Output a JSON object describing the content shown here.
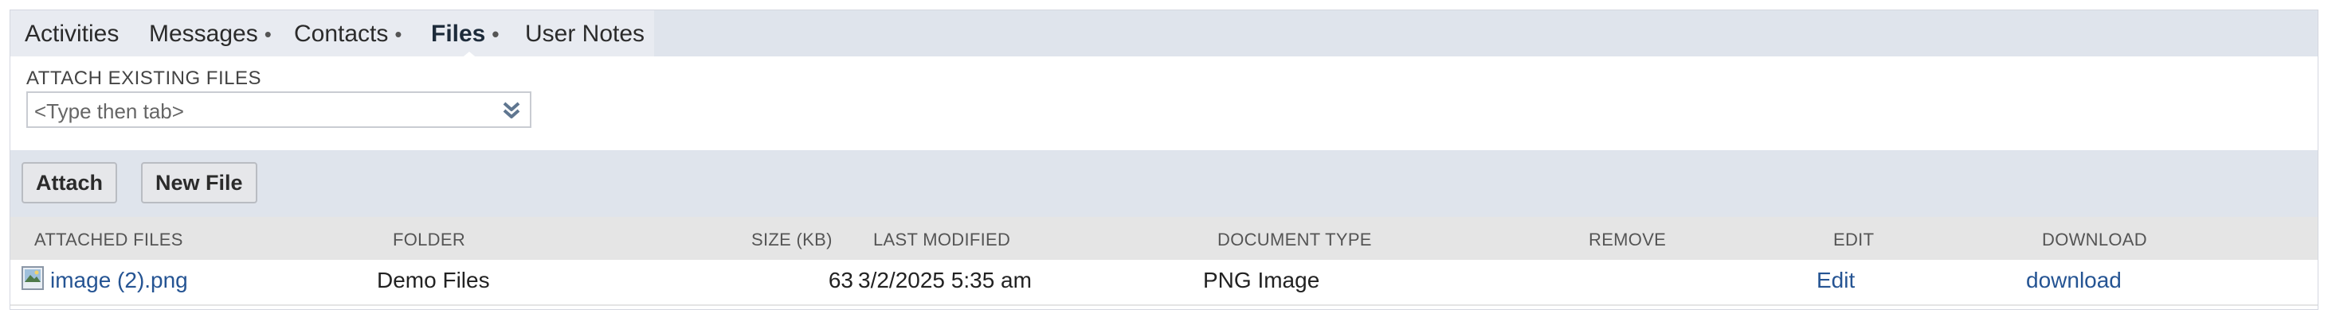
{
  "tabs": [
    {
      "label": "Activities"
    },
    {
      "label": "Messages",
      "marker": "•"
    },
    {
      "label": "Contacts",
      "marker": "•"
    },
    {
      "label": "Files",
      "marker": "•"
    },
    {
      "label": "User Notes"
    }
  ],
  "active_tab": "Files",
  "attach_existing": {
    "label": "ATTACH EXISTING FILES",
    "placeholder": "<Type then tab>"
  },
  "buttons": {
    "attach": "Attach",
    "new_file": "New File"
  },
  "table": {
    "columns": [
      "ATTACHED FILES",
      "FOLDER",
      "SIZE (KB)",
      "LAST MODIFIED",
      "DOCUMENT TYPE",
      "REMOVE",
      "EDIT",
      "DOWNLOAD"
    ],
    "rows": [
      {
        "file": "image (2).png",
        "folder": "Demo Files",
        "size_kb": "63",
        "last_modified": "3/2/2025 5:35 am",
        "document_type": "PNG Image",
        "edit": "Edit",
        "download": "download"
      }
    ]
  },
  "icons": {
    "dropdown": "double-chevron-down-icon",
    "file": "image-file-icon"
  },
  "colors": {
    "link": "#255493",
    "tabbar_bg": "#dfe4ec",
    "header_bg": "#e5e5e5"
  }
}
